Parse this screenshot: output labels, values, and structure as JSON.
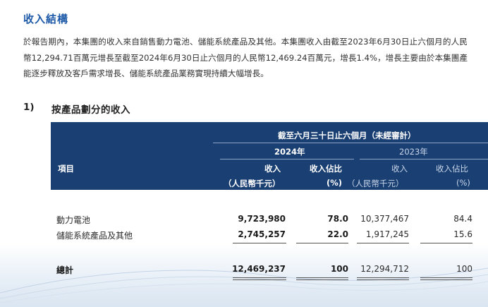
{
  "section": {
    "title": "收入結構",
    "paragraph": "於報告期內，本集團的收入來自銷售動力電池、儲能系統產品及其他。本集團收入由截至2023年6月30日止六個月的人民幣12,294.71百萬元增長至截至2024年6月30日止六個月的人民幣12,469.24百萬元，增長1.4%，增長主要由於本集團產能逐步釋放及客戶需求增長、儲能系統產品業務實現持續大幅增長。"
  },
  "subsection": {
    "number": "1)",
    "title": "按產品劃分的收入"
  },
  "table": {
    "period_header": "截至六月三十日止六個月（未經審計）",
    "year_current": "2024年",
    "year_prior": "2023年",
    "item_header": "項目",
    "col_revenue": "收入",
    "col_share": "收入佔比",
    "unit_revenue": "（人民幣千元）",
    "unit_share": "(%)",
    "rows": [
      {
        "item": "動力電池",
        "rev_2024": "9,723,980",
        "share_2024": "78.0",
        "rev_2023": "10,377,467",
        "share_2023": "84.4"
      },
      {
        "item": "儲能系統產品及其他",
        "rev_2024": "2,745,257",
        "share_2024": "22.0",
        "rev_2023": "1,917,245",
        "share_2023": "15.6"
      }
    ],
    "total": {
      "item": "總計",
      "rev_2024": "12,469,237",
      "share_2024": "100",
      "rev_2023": "12,294,712",
      "share_2023": "100"
    }
  }
}
